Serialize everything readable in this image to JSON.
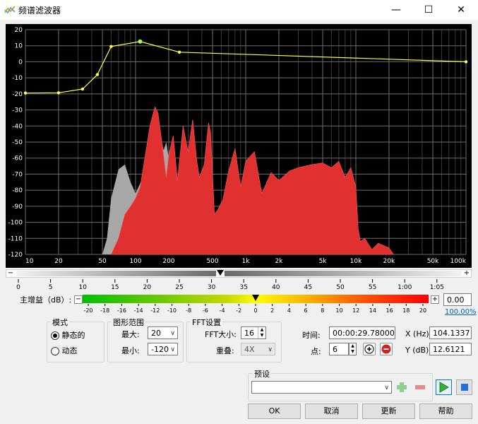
{
  "window": {
    "title": "频谱滤波器",
    "minimize_icon": "minimize-icon",
    "maximize_icon": "maximize-icon",
    "close_icon": "close-icon"
  },
  "chart_data": {
    "type": "area",
    "x_scale": "log",
    "xlim": [
      10,
      100000
    ],
    "ylim": [
      -120,
      20
    ],
    "grid": true,
    "x_tick_labels": [
      "10",
      "20",
      "50",
      "100",
      "200",
      "500",
      "1k",
      "2k",
      "5k",
      "10k",
      "20k",
      "50k",
      "100k"
    ],
    "x_tick_values": [
      10,
      20,
      50,
      100,
      200,
      500,
      1000,
      2000,
      5000,
      10000,
      20000,
      50000,
      100000
    ],
    "y_tick_values": [
      20,
      10,
      0,
      -10,
      -20,
      -30,
      -40,
      -50,
      -60,
      -70,
      -80,
      -90,
      -100,
      -110,
      -120
    ],
    "filter_curve": {
      "color": "#ffff40",
      "points": [
        [
          10,
          -19.5
        ],
        [
          20,
          -19.3
        ],
        [
          33,
          -17
        ],
        [
          45,
          -8
        ],
        [
          60,
          9.5
        ],
        [
          110,
          12.6
        ],
        [
          250,
          6
        ],
        [
          100000,
          0
        ]
      ]
    },
    "spectrum_previous": {
      "color": "#a8a8a8",
      "points": [
        [
          50,
          -120
        ],
        [
          55,
          -110
        ],
        [
          60,
          -85
        ],
        [
          70,
          -67
        ],
        [
          80,
          -64
        ],
        [
          90,
          -75
        ],
        [
          100,
          -82
        ],
        [
          130,
          -65
        ],
        [
          150,
          -55
        ],
        [
          170,
          -48
        ],
        [
          180,
          -55
        ],
        [
          190,
          -50
        ],
        [
          200,
          -60
        ],
        [
          220,
          -90
        ],
        [
          250,
          -120
        ]
      ]
    },
    "spectrum_current": {
      "color": "#e03030",
      "points": [
        [
          60,
          -120
        ],
        [
          70,
          -110
        ],
        [
          80,
          -95
        ],
        [
          90,
          -90
        ],
        [
          100,
          -85
        ],
        [
          110,
          -78
        ],
        [
          120,
          -62
        ],
        [
          135,
          -40
        ],
        [
          150,
          -28
        ],
        [
          160,
          -32
        ],
        [
          175,
          -52
        ],
        [
          190,
          -72
        ],
        [
          200,
          -58
        ],
        [
          220,
          -46
        ],
        [
          240,
          -74
        ],
        [
          270,
          -40
        ],
        [
          300,
          -56
        ],
        [
          330,
          -36
        ],
        [
          360,
          -62
        ],
        [
          380,
          -72
        ],
        [
          420,
          -64
        ],
        [
          460,
          -38
        ],
        [
          480,
          -44
        ],
        [
          520,
          -95
        ],
        [
          560,
          -92
        ],
        [
          620,
          -86
        ],
        [
          700,
          -68
        ],
        [
          800,
          -54
        ],
        [
          900,
          -78
        ],
        [
          1000,
          -62
        ],
        [
          1200,
          -56
        ],
        [
          1400,
          -82
        ],
        [
          1700,
          -69
        ],
        [
          2000,
          -74
        ],
        [
          2500,
          -68
        ],
        [
          3000,
          -66
        ],
        [
          4000,
          -64
        ],
        [
          5000,
          -63
        ],
        [
          6000,
          -66
        ],
        [
          7000,
          -62
        ],
        [
          8000,
          -72
        ],
        [
          9000,
          -66
        ],
        [
          10000,
          -78
        ],
        [
          10500,
          -104
        ],
        [
          11000,
          -112
        ],
        [
          12000,
          -110
        ],
        [
          14000,
          -117
        ],
        [
          16000,
          -113
        ],
        [
          20000,
          -116
        ],
        [
          22000,
          -120
        ]
      ]
    }
  },
  "scroll": {
    "left_arrow": "−",
    "right_arrow": "+"
  },
  "time_ruler": {
    "labels": [
      "0",
      "5",
      "10",
      "15",
      "20",
      "25",
      "30",
      "35",
      "40",
      "45",
      "50",
      "55",
      "1:00",
      "1:05"
    ],
    "thumb_color": "#000000"
  },
  "gain": {
    "label": "主增益（dB）:",
    "minus": "−",
    "plus": "+",
    "value": "0.00",
    "percent": "100.00%",
    "ticks": [
      "-20",
      "-18",
      "-16",
      "-14",
      "-12",
      "-10",
      "-8",
      "-6",
      "-4",
      "-2",
      "0",
      "2",
      "4",
      "6",
      "8",
      "10",
      "12",
      "14",
      "16",
      "18",
      "20"
    ],
    "gradient_colors": [
      "#00c000",
      "#c8d800",
      "#ffff00",
      "#ffa000",
      "#ff0000"
    ]
  },
  "mode": {
    "title": "模式",
    "static_label": "静态的",
    "dynamic_label": "动态",
    "selected": "静态的"
  },
  "range": {
    "title": "图形范围",
    "max_label": "最大:",
    "max_value": "20",
    "min_label": "最小:",
    "min_value": "-120"
  },
  "fft": {
    "title": "FFT设置",
    "size_label": "FFT大小:",
    "size_value": "16",
    "overlap_label": "重叠:",
    "overlap_value": "4X"
  },
  "info": {
    "time_label": "时间:",
    "time_value": "00:00:29.78000",
    "point_label": "点:",
    "point_value": "6",
    "x_label": "X (Hz):",
    "x_value": "104.1337",
    "y_label": "Y (dB):",
    "y_value": "12.6121"
  },
  "preset": {
    "title": "预设",
    "value": ""
  },
  "buttons": {
    "ok": "OK",
    "cancel": "取消",
    "update": "更新",
    "help": "帮助"
  }
}
